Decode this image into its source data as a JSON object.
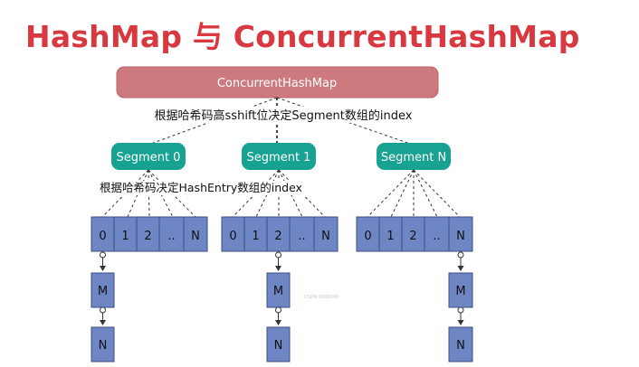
{
  "title": "HashMap 与 ConcurrentHashMap",
  "root": {
    "label": "ConcurrentHashMap",
    "color": "#cc7a7d"
  },
  "segment_rule": "根据哈希码高sshift位决定Segment数组的index",
  "entry_rule": "根据哈希码决定HashEntry数组的index",
  "segments": [
    {
      "label": "Segment 0"
    },
    {
      "label": "Segment 1"
    },
    {
      "label": "Segment N"
    }
  ],
  "cells": [
    "0",
    "1",
    "2",
    "..",
    "N"
  ],
  "chain_nodes": [
    "M",
    "N"
  ],
  "watermark": "CSDN 0000000",
  "colors": {
    "segment": "#17a291",
    "cell": "#6f86c4",
    "cell_border": "#3b4f86",
    "title": "#d8383f"
  }
}
